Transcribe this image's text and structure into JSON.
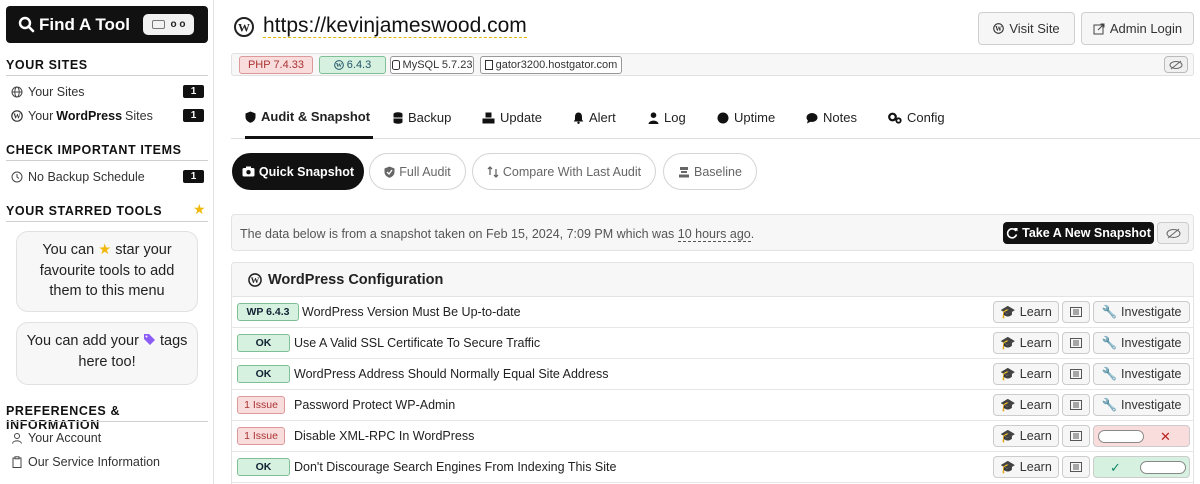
{
  "sidebar": {
    "find_tool": {
      "label": "Find A Tool",
      "shortcut": "o o"
    },
    "your_sites": {
      "title": "YOUR SITES",
      "items": [
        {
          "label": "Your Sites",
          "count": "1"
        },
        {
          "prefix": "Your",
          "bold": "WordPress",
          "suffix": "Sites",
          "count": "1"
        }
      ]
    },
    "check_items": {
      "title": "CHECK IMPORTANT ITEMS",
      "items": [
        {
          "label": "No Backup Schedule",
          "count": "1"
        }
      ]
    },
    "starred": {
      "title": "YOUR STARRED TOOLS",
      "note1_a": "You can",
      "note1_b": "star your favourite tools to add them to this menu",
      "note2_a": "You can add your",
      "note2_b": "tags here too!"
    },
    "prefs": {
      "title": "PREFERENCES & INFORMATION",
      "items": [
        {
          "label": "Your Account"
        },
        {
          "label": "Our Service Information"
        }
      ]
    }
  },
  "header": {
    "url": "https://kevinjameswood.com",
    "visit_site": "Visit Site",
    "admin_login": "Admin Login"
  },
  "infobar": {
    "php": "PHP 7.4.33",
    "wp": "6.4.3",
    "mysql": "MySQL 5.7.23",
    "host": "gator3200.hostgator.com"
  },
  "tabs": [
    "Audit & Snapshot",
    "Backup",
    "Update",
    "Alert",
    "Log",
    "Uptime",
    "Notes",
    "Config"
  ],
  "subtabs": [
    "Quick Snapshot",
    "Full Audit",
    "Compare With Last Audit",
    "Baseline"
  ],
  "snapshot": {
    "text_a": "The data below is from a snapshot taken on Feb 15, 2024, 7:09 PM which was",
    "ago": "10 hours ago",
    "text_b": ".",
    "button": "Take A New Snapshot"
  },
  "config": {
    "title": "WordPress Configuration",
    "learn": "Learn",
    "investigate": "Investigate",
    "rows": [
      {
        "badge": "WP 6.4.3",
        "text": "WordPress Version Must Be Up-to-date"
      },
      {
        "badge": "OK",
        "text": "Use A Valid SSL Certificate To Secure Traffic"
      },
      {
        "badge": "OK",
        "text": "WordPress Address Should Normally Equal Site Address"
      },
      {
        "badge": "1 Issue",
        "text": "Password Protect WP-Admin"
      },
      {
        "badge": "1 Issue",
        "text": "Disable XML-RPC In WordPress"
      },
      {
        "badge": "OK",
        "text": "Don't Discourage Search Engines From Indexing This Site"
      }
    ]
  },
  "colors": {
    "dark": "#111111",
    "ok_green": "#d6f1e0",
    "issue_red": "#f9dcdc",
    "star": "#f0b90b",
    "tag_purple": "#8b5cf6"
  }
}
